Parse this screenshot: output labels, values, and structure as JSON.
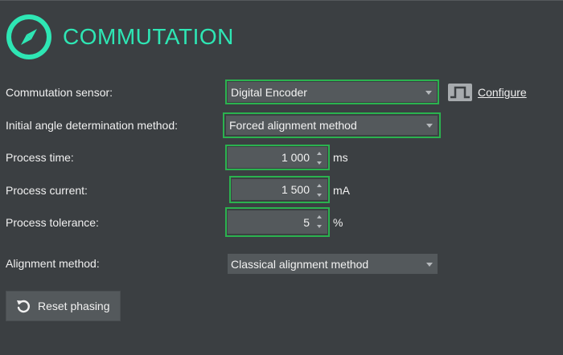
{
  "header": {
    "title": "COMMUTATION",
    "icon": "compass-icon",
    "accent": "#2ee6b4"
  },
  "colors": {
    "background": "#3b3f42",
    "field": "#54595c",
    "highlight_outline": "#2bb24f"
  },
  "commutation_sensor": {
    "label": "Commutation sensor:",
    "value": "Digital Encoder",
    "configure_icon": "square-wave-icon",
    "configure_label": "Configure"
  },
  "initial_angle": {
    "label": "Initial angle determination method:",
    "value": "Forced alignment method"
  },
  "process_time": {
    "label": "Process time:",
    "value": "1 000",
    "unit": "ms"
  },
  "process_current": {
    "label": "Process current:",
    "value": "1 500",
    "unit": "mA"
  },
  "process_tolerance": {
    "label": "Process tolerance:",
    "value": "5",
    "unit": "%"
  },
  "alignment_method": {
    "label": "Alignment method:",
    "value": "Classical alignment method"
  },
  "reset_button": {
    "label": "Reset phasing",
    "icon": "reset-icon"
  }
}
